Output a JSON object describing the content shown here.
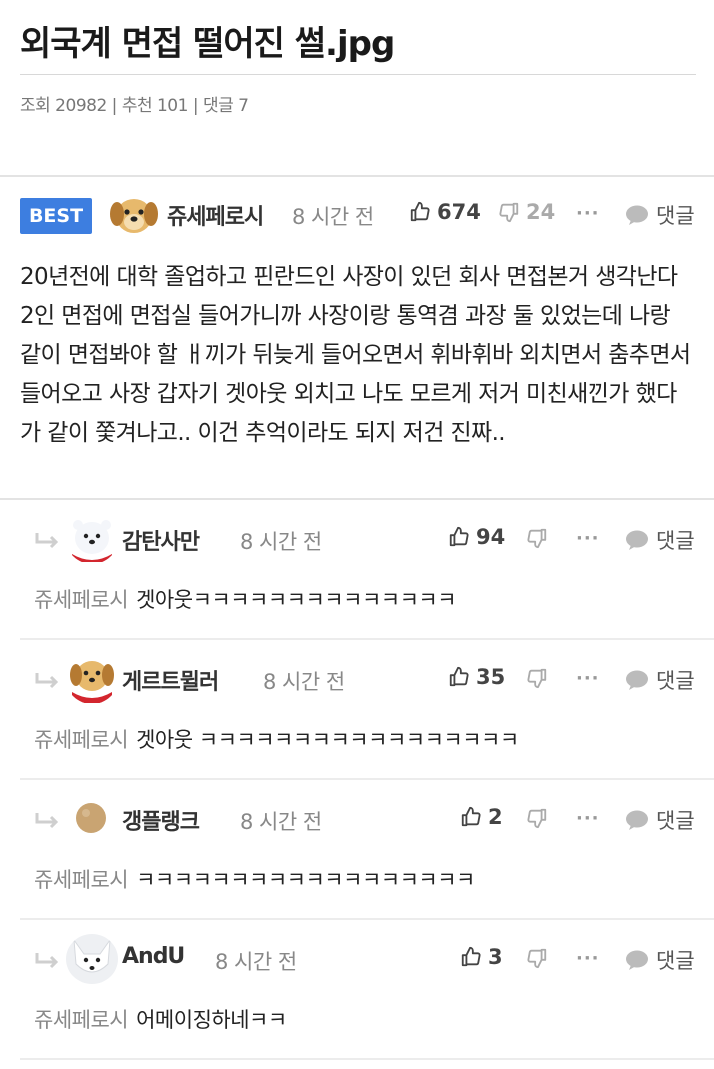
{
  "post": {
    "title": "외국계 면접 떨어진 썰.jpg",
    "views_label": "조회 20982",
    "recommend_label": "추천 101",
    "comments_label": "댓글 7",
    "sep": "|"
  },
  "best": {
    "badge": "BEST",
    "author": "쥬세페로시",
    "time": "8 시간 전",
    "likes": "674",
    "dislikes": "24",
    "more": "···",
    "reply_label": "댓글",
    "body": "20년전에 대학 졸업하고 핀란드인 사장이 있던 회사 면접본거 생각난다 2인 면접에 면접실 들어가니까 사장이랑 통역겸 과장 둘 있었는데 나랑 같이 면접봐야 할   ㅐ끼가 뒤늦게 들어오면서 휘바휘바 외치면서 춤추면서 들어오고 사장 갑자기 겟아웃 외치고 나도 모르게 저거 미친새낀가 했다가 같이 쫓겨나고.. 이건 추억이라도 되지 저건 진짜..",
    "avatar_icon": "puppy-avatar-icon"
  },
  "replies": [
    {
      "author": "감탄사만",
      "time": "8 시간 전",
      "likes": "94",
      "more": "···",
      "reply_label": "댓글",
      "reply_to": "쥬세페로시",
      "text": "겟아웃ㅋㅋㅋㅋㅋㅋㅋㅋㅋㅋㅋㅋㅋㅋ",
      "avatar_icon": "polar-bear-santa-avatar-icon"
    },
    {
      "author": "게르트뮐러",
      "time": "8 시간 전",
      "likes": "35",
      "more": "···",
      "reply_label": "댓글",
      "reply_to": "쥬세페로시",
      "text": "겟아웃 ㅋㅋㅋㅋㅋㅋㅋㅋㅋㅋㅋㅋㅋㅋㅋㅋㅋ",
      "avatar_icon": "puppy-santa-avatar-icon"
    },
    {
      "author": "갱플랭크",
      "time": "8 시간 전",
      "likes": "2",
      "more": "···",
      "reply_label": "댓글",
      "reply_to": "쥬세페로시",
      "text": "ㅋㅋㅋㅋㅋㅋㅋㅋㅋㅋㅋㅋㅋㅋㅋㅋㅋㅋ",
      "avatar_icon": "round-ball-avatar-icon"
    },
    {
      "author": "AndU",
      "time": "8 시간 전",
      "likes": "3",
      "more": "···",
      "reply_label": "댓글",
      "reply_to": "쥬세페로시",
      "text": "어메이징하네ㅋㅋ",
      "avatar_icon": "white-fox-avatar-icon"
    }
  ],
  "colors": {
    "best_badge": "#3d7ee0",
    "muted": "#888888",
    "divider": "#ececec"
  }
}
